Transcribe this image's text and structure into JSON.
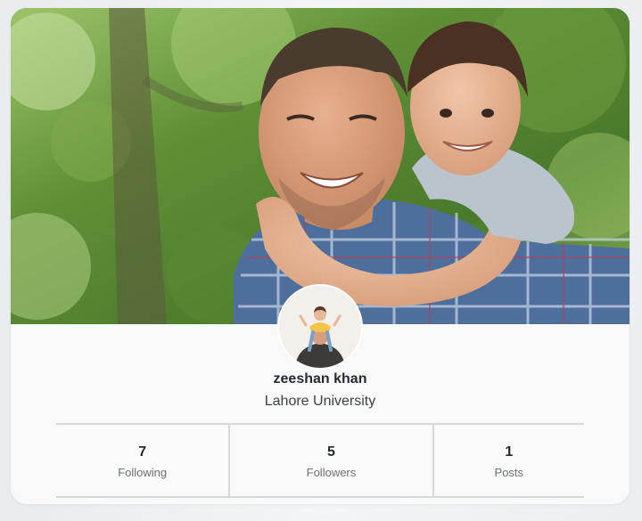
{
  "profile": {
    "name": "zeeshan khan",
    "affiliation": "Lahore University"
  },
  "stats": [
    {
      "value": "7",
      "label": "Following"
    },
    {
      "value": "5",
      "label": "Followers"
    },
    {
      "value": "1",
      "label": "Posts"
    }
  ],
  "colors": {
    "card_background": "#f9f9fa",
    "text_primary": "#252a33",
    "text_secondary": "#6b717b",
    "divider": "#d6d8dc"
  }
}
